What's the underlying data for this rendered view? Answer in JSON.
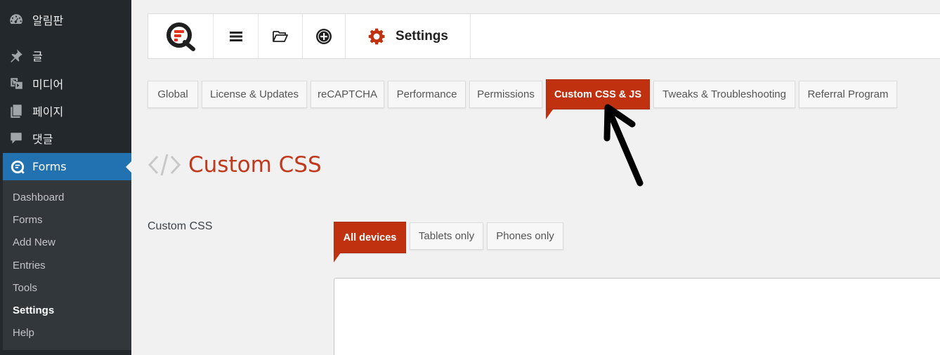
{
  "sidebar": {
    "menu": [
      {
        "label": "알림판",
        "icon": "dashboard-icon"
      },
      {
        "label": "글",
        "icon": "pin-icon"
      },
      {
        "label": "미디어",
        "icon": "media-icon"
      },
      {
        "label": "페이지",
        "icon": "pages-icon"
      },
      {
        "label": "댓글",
        "icon": "comments-icon"
      },
      {
        "label": "Forms",
        "icon": "quform-logo-icon"
      }
    ],
    "submenu": [
      "Dashboard",
      "Forms",
      "Add New",
      "Entries",
      "Tools",
      "Settings",
      "Help"
    ],
    "active_submenu": "Settings"
  },
  "topbar": {
    "logo": "quform-logo-icon",
    "icons": [
      "menu-icon",
      "folder-open-icon",
      "add-circle-icon"
    ],
    "page_icon": "gear-icon",
    "title": "Settings"
  },
  "tabs": [
    "Global",
    "License & Updates",
    "reCAPTCHA",
    "Performance",
    "Permissions",
    "Custom CSS & JS",
    "Tweaks & Troubleshooting",
    "Referral Program"
  ],
  "active_tab": "Custom CSS & JS",
  "section": {
    "icon": "code-icon",
    "title": "Custom CSS"
  },
  "field": {
    "label": "Custom CSS",
    "device_tabs": [
      "All devices",
      "Tablets only",
      "Phones only"
    ],
    "active_device_tab": "All devices",
    "editor_value": ""
  },
  "colors": {
    "accent": "#c0310f",
    "wp_sidebar": "#23282d",
    "wp_current": "#2271b1"
  }
}
